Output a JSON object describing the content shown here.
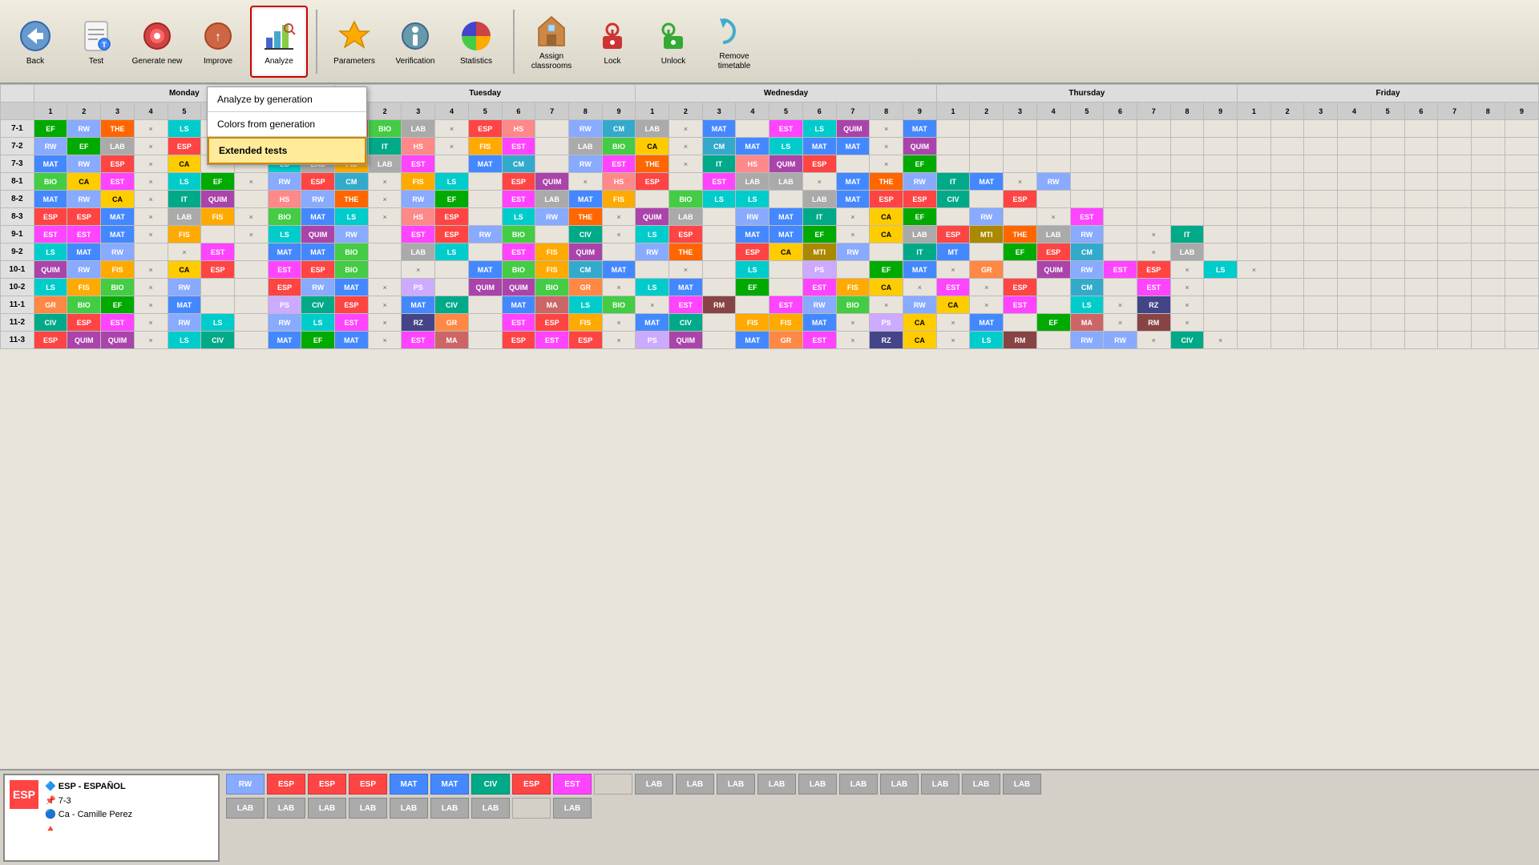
{
  "toolbar": {
    "back_label": "Back",
    "test_label": "Test",
    "generate_label": "Generate\nnew",
    "improve_label": "Improve",
    "analyze_label": "Analyze",
    "parameters_label": "Parameters",
    "verification_label": "Verification",
    "statistics_label": "Statistics",
    "assign_classrooms_label": "Assign\nclassrooms",
    "lock_label": "Lock",
    "unlock_label": "Unlock",
    "remove_timetable_label": "Remove\ntimetable"
  },
  "dropdown": {
    "items": [
      {
        "label": "Analyze by generation",
        "highlighted": false
      },
      {
        "label": "Colors from generation",
        "highlighted": false
      },
      {
        "label": "Extended tests",
        "highlighted": true
      }
    ]
  },
  "days": [
    "Monday",
    "Tuesday",
    "Wednesday",
    "Thursday",
    "Friday"
  ],
  "slots": [
    1,
    2,
    3,
    4,
    5,
    6,
    7,
    8,
    9
  ],
  "info": {
    "badge": "ESP",
    "subject": "ESP - ESPAÑOL",
    "grade": "7-3",
    "teacher": "Ca - Camille Perez"
  }
}
